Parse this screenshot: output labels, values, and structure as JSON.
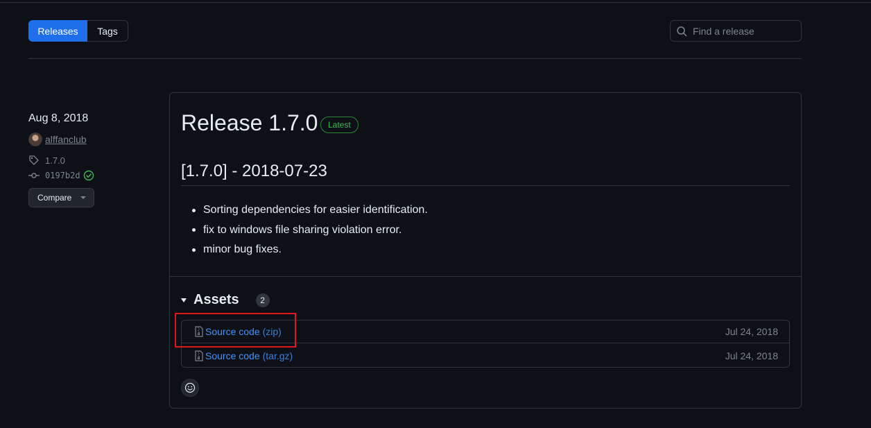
{
  "tabs": {
    "releases": "Releases",
    "tags": "Tags"
  },
  "search": {
    "placeholder": "Find a release"
  },
  "sidebar": {
    "date": "Aug 8, 2018",
    "author": "alffanclub",
    "tag": "1.7.0",
    "commit": "0197b2d",
    "compare_label": "Compare"
  },
  "release": {
    "title": "Release 1.7.0",
    "badge": "Latest",
    "version_heading": "[1.7.0] - 2018-07-23",
    "notes": [
      "Sorting dependencies for easier identification.",
      "fix to windows file sharing violation error.",
      "minor bug fixes."
    ],
    "assets": {
      "title": "Assets",
      "count": "2",
      "items": [
        {
          "label": "Source code",
          "ext": "(zip)",
          "date": "Jul 24, 2018"
        },
        {
          "label": "Source code",
          "ext": "(tar.gz)",
          "date": "Jul 24, 2018"
        }
      ]
    }
  },
  "colors": {
    "background": "#0d1117",
    "accent": "#1f6feb",
    "link": "#4493f8",
    "badge_green": "#3fb950",
    "highlight_red": "#e0161c"
  }
}
